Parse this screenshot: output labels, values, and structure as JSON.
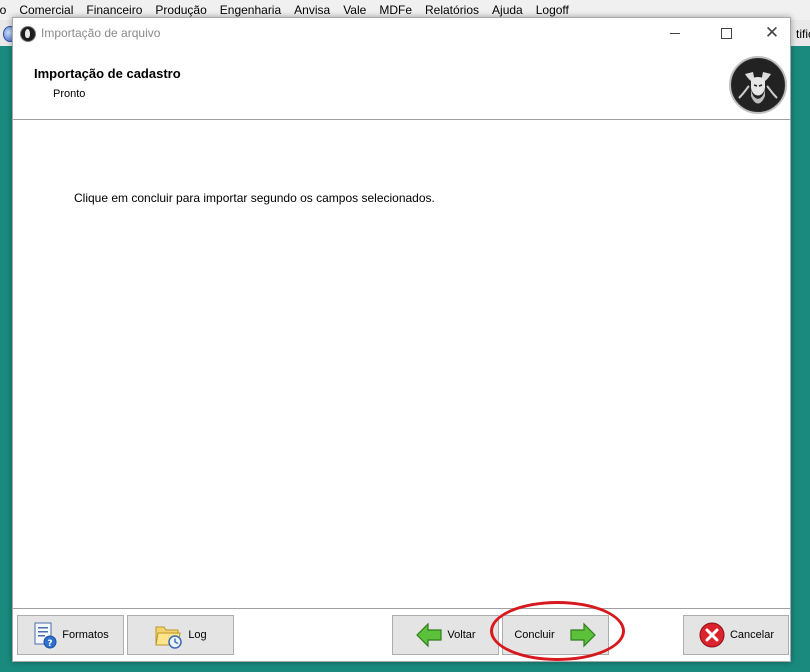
{
  "app": {
    "menu": [
      "io",
      "Comercial",
      "Financeiro",
      "Produção",
      "Engenharia",
      "Anvisa",
      "Vale",
      "MDFe",
      "Relatórios",
      "Ajuda",
      "Logoff"
    ],
    "toolbar_right_text": "tific"
  },
  "dialog": {
    "title": "Importação de arquivo",
    "header_title": "Importação de cadastro",
    "header_status": "Pronto",
    "message": "Clique em concluir para importar segundo os campos selecionados.",
    "buttons": {
      "formatos": "Formatos",
      "log": "Log",
      "voltar": "Voltar",
      "concluir": "Concluir",
      "cancelar": "Cancelar"
    }
  },
  "colors": {
    "desktop": "#1a8a7e",
    "annotation": "#d7191e",
    "arrow_green": "#4caf2a",
    "cancel_red": "#d9232d"
  }
}
